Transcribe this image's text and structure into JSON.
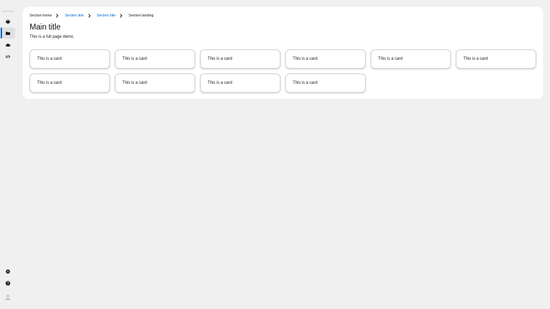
{
  "breadcrumb": {
    "items": [
      {
        "label": "Section home",
        "link": false
      },
      {
        "label": "Section title",
        "link": true
      },
      {
        "label": "Section title",
        "link": true
      },
      {
        "label": "Section landing",
        "link": false
      }
    ]
  },
  "page": {
    "title": "Main title",
    "subtitle": "This is a full page demo."
  },
  "cards": [
    "This is a card",
    "This is a card",
    "This is a card",
    "This is a card",
    "This is a card",
    "This is a card",
    "This is a card",
    "This is a card",
    "This is a card",
    "This is a card"
  ],
  "sidebar": {
    "items": [
      {
        "icon": "cube-icon"
      },
      {
        "icon": "folder-icon",
        "active": true
      },
      {
        "icon": "cloud-icon"
      },
      {
        "icon": "code-icon"
      }
    ],
    "bottom_items": [
      {
        "icon": "gear-icon"
      },
      {
        "icon": "help-icon"
      },
      {
        "icon": "user-avatar-icon"
      }
    ]
  },
  "colors": {
    "accent": "#0066cc",
    "background": "#f0f0f0",
    "panel": "#ffffff",
    "text": "#151515"
  }
}
